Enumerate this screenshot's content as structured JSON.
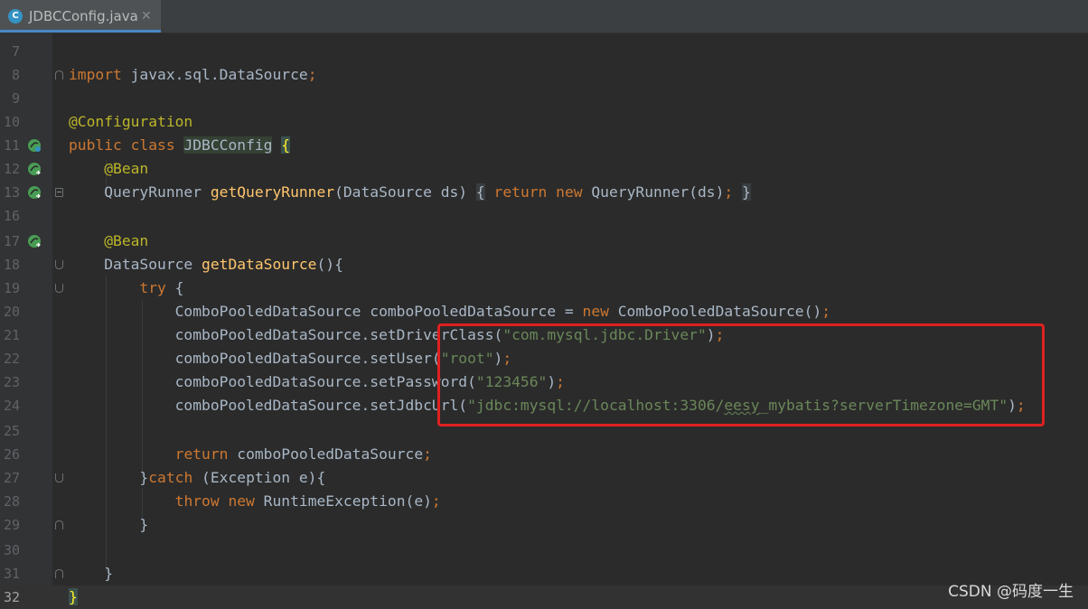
{
  "tab": {
    "icon_letter": "C",
    "icon_name": "java-class-icon",
    "label": "JDBCConfig.java",
    "close": "✕"
  },
  "lines": [
    {
      "num": "7",
      "code": ""
    },
    {
      "num": "8",
      "code": "import javax.sql.DataSource;"
    },
    {
      "num": "9",
      "code": ""
    },
    {
      "num": "10",
      "code": "@Configuration"
    },
    {
      "num": "11",
      "code": "public class JDBCConfig {"
    },
    {
      "num": "12",
      "code": "    @Bean"
    },
    {
      "num": "13",
      "code": "    QueryRunner getQueryRunner(DataSource ds) { return new QueryRunner(ds); }"
    },
    {
      "num": "16",
      "code": ""
    },
    {
      "num": "17",
      "code": "    @Bean"
    },
    {
      "num": "18",
      "code": "    DataSource getDataSource(){"
    },
    {
      "num": "19",
      "code": "        try {"
    },
    {
      "num": "20",
      "code": "            ComboPooledDataSource comboPooledDataSource = new ComboPooledDataSource();"
    },
    {
      "num": "21",
      "code": "            comboPooledDataSource.setDriverClass(\"com.mysql.jdbc.Driver\");"
    },
    {
      "num": "22",
      "code": "            comboPooledDataSource.setUser(\"root\");"
    },
    {
      "num": "23",
      "code": "            comboPooledDataSource.setPassword(\"123456\");"
    },
    {
      "num": "24",
      "code": "            comboPooledDataSource.setJdbcUrl(\"jdbc:mysql://localhost:3306/eesy_mybatis?serverTimezone=GMT\");"
    },
    {
      "num": "25",
      "code": ""
    },
    {
      "num": "26",
      "code": "            return comboPooledDataSource;"
    },
    {
      "num": "27",
      "code": "        }catch (Exception e){"
    },
    {
      "num": "28",
      "code": "            throw new RuntimeException(e);"
    },
    {
      "num": "29",
      "code": "        }"
    },
    {
      "num": "30",
      "code": ""
    },
    {
      "num": "31",
      "code": "    }"
    },
    {
      "num": "32",
      "code": "}"
    }
  ],
  "gutter_icons": [
    "bean-icon",
    "bean-icon",
    "bean-icon",
    "bean-icon"
  ],
  "watermark": "CSDN @码度一生",
  "colors": {
    "background": "#2b2b2b",
    "keyword": "#cc7832",
    "annotation": "#bbb529",
    "method": "#ffc66d",
    "string": "#6a8759",
    "plain": "#a9b7c6",
    "highlight_box": "#e02020"
  }
}
